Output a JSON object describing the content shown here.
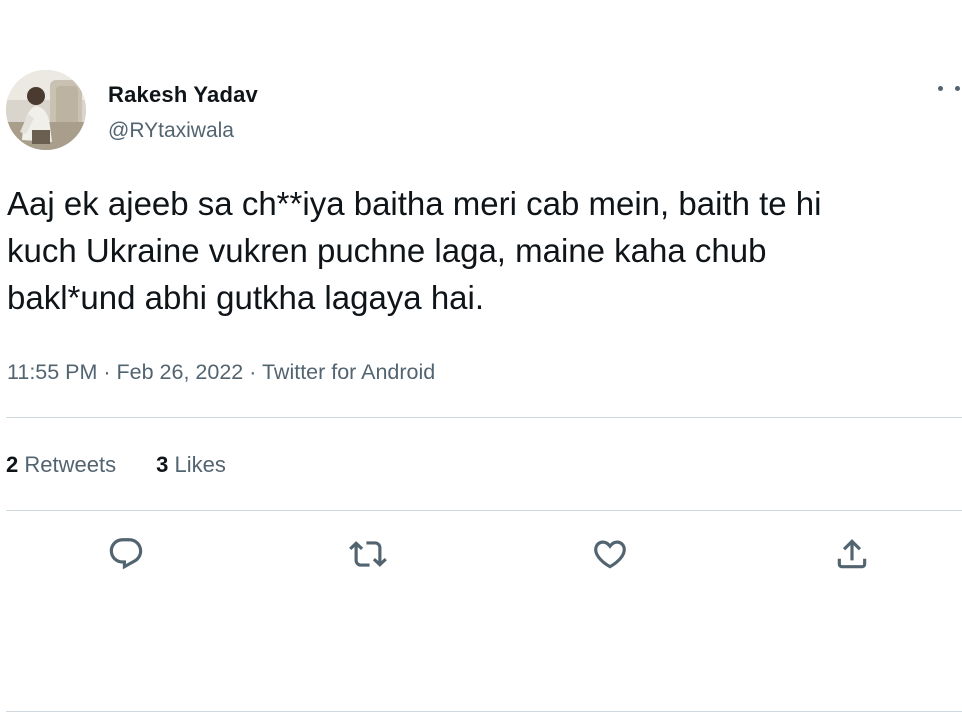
{
  "author": {
    "name": "Rakesh Yadav",
    "handle": "@RYtaxiwala"
  },
  "tweet": {
    "text_lines": [
      "Aaj ek ajeeb sa ch**iya baitha meri cab mein, baith te hi",
      "kuch Ukraine vukren puchne laga, maine kaha chub",
      "bakl*und abhi gutkha lagaya hai."
    ],
    "meta": "11:55 PM · Feb 26, 2022 · Twitter for Android"
  },
  "stats": {
    "retweets_count": "2",
    "retweets_label": "Retweets",
    "likes_count": "3",
    "likes_label": "Likes"
  },
  "actions": {
    "reply": "reply-icon",
    "retweet": "retweet-icon",
    "like": "heart-icon",
    "share": "share-icon"
  },
  "colors": {
    "text": "#0f1419",
    "secondary": "#536471",
    "divider": "#cfd9de"
  }
}
